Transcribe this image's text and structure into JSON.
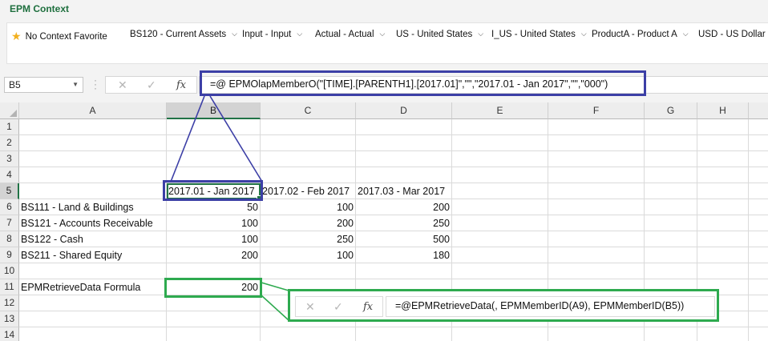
{
  "epm": {
    "title": "EPM Context",
    "favorite": "No Context Favorite",
    "dimensions": [
      {
        "label": "BS120 - Current Assets"
      },
      {
        "label": "Input - Input"
      },
      {
        "label": "Actual - Actual"
      },
      {
        "label": "US - United States"
      },
      {
        "label": "I_US - United States"
      },
      {
        "label": "ProductA - Product A"
      },
      {
        "label": "USD - US Dollar"
      }
    ]
  },
  "formula_bar": {
    "name_box": "B5",
    "formula": "=@ EPMOlapMemberO(\"[TIME].[PARENTH1].[2017.01]\",\"\",\"2017.01 - Jan 2017\",\"\",\"000\")",
    "cancel_icon": "✕",
    "enter_icon": "✓",
    "fx_label": "fx"
  },
  "columns": [
    "A",
    "B",
    "C",
    "D",
    "E",
    "F",
    "G",
    "H"
  ],
  "rows": [
    "1",
    "2",
    "3",
    "4",
    "5",
    "6",
    "7",
    "8",
    "9",
    "10",
    "11",
    "12",
    "13",
    "14"
  ],
  "sheet": {
    "headers": [
      "2017.01 - Jan 2017",
      "2017.02 - Feb 2017",
      "2017.03 - Mar 2017"
    ],
    "data": [
      {
        "label": "BS111 - Land & Buildings",
        "values": [
          "50",
          "100",
          "200"
        ]
      },
      {
        "label": "BS121 - Accounts Receivable",
        "values": [
          "100",
          "200",
          "250"
        ]
      },
      {
        "label": "BS122 - Cash",
        "values": [
          "100",
          "250",
          "500"
        ]
      },
      {
        "label": "BS211 - Shared Equity",
        "values": [
          "200",
          "100",
          "180"
        ]
      }
    ],
    "retrieve_label": "EPMRetrieveData Formula",
    "retrieve_value": "200"
  },
  "callout": {
    "formula": "=@EPMRetrieveData(, EPMMemberID(A9), EPMMemberID(B5))",
    "cancel_icon": "✕",
    "enter_icon": "✓",
    "fx_label": "fx"
  },
  "colors": {
    "highlight_blue": "#3c3fa6",
    "highlight_green": "#2eaa4f",
    "excel_green": "#217346",
    "epm_title": "#1e6f3e",
    "star": "#f2b01e"
  }
}
